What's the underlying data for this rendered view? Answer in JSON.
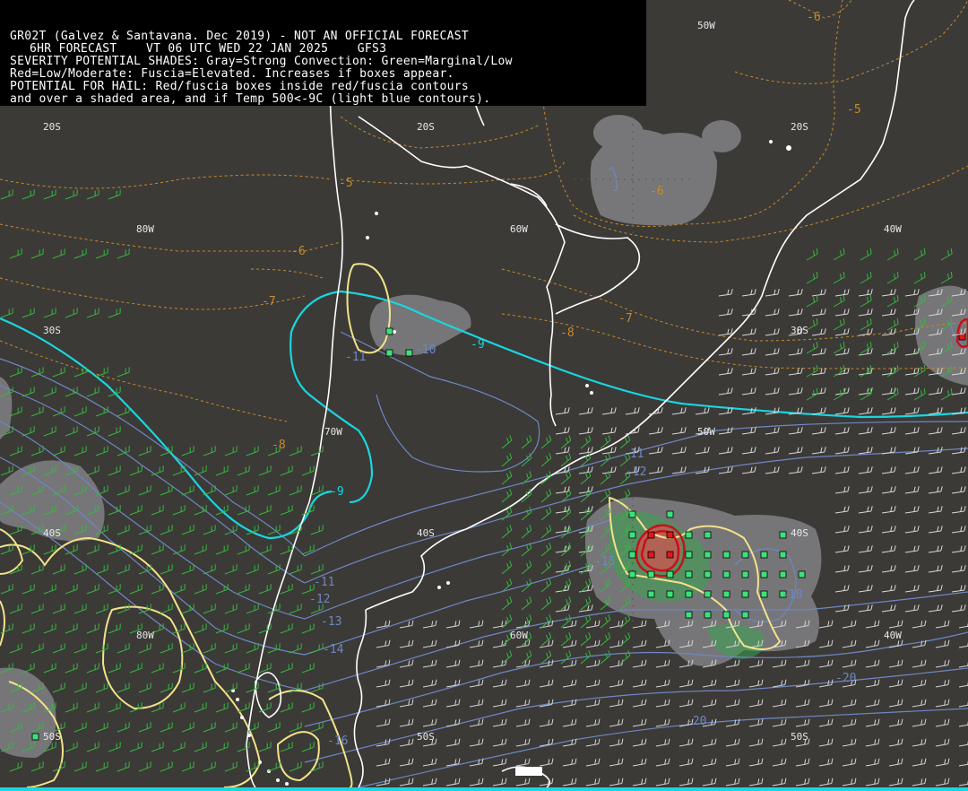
{
  "header": {
    "line1": "GR02T (Galvez & Santavana. Dec 2019) - NOT AN OFFICIAL FORECAST",
    "line2": "6HR FORECAST    VT 06 UTC WED 22 JAN 2025    GFS3",
    "line3": "SEVERITY POTENTIAL SHADES: Gray=Strong Convection: Green=Marginal/Low",
    "line4": "Red=Low/Moderate: Fuscia=Elevated. Increases if boxes appear.",
    "line5": "POTENTIAL FOR HAIL: Red/fuscia boxes inside red/fuscia contours",
    "line6": "and over a shaded area, and if Temp 500<-9C (light blue contours)."
  },
  "grid_labels": {
    "lat_20s_a": "20S",
    "lat_20s_b": "20S",
    "lat_20s_c": "20S",
    "lat_30s_a": "30S",
    "lat_30s_b": "30S",
    "lat_40s_a": "40S",
    "lat_40s_b": "40S",
    "lat_40s_c": "40S",
    "lat_50s_a": "50S",
    "lat_50s_b": "50S",
    "lat_50s_c": "50S",
    "lon_80w_a": "80W",
    "lon_80w_b": "80W",
    "lon_70w": "70W",
    "lon_60w_a": "60W",
    "lon_60w_b": "60W",
    "lon_50w_a": "50W",
    "lon_50w_b": "50W",
    "lon_40w_a": "40W",
    "lon_40w_b": "40W"
  },
  "contour_labels": {
    "orange_m5_a": "-5",
    "orange_m5_b": "-5",
    "orange_m6_a": "-6",
    "orange_m6_b": "-6",
    "orange_m6_c": "-6",
    "orange_m7_a": "-7",
    "orange_m7_b": "-7",
    "orange_m8_a": "-8",
    "orange_m8_b": "-8",
    "cyan_m9_a": "-9",
    "cyan_m9_b": "-9",
    "blue_m10": "-10",
    "blue_m11_a": "-11",
    "blue_m11_b": "-11",
    "blue_m11_c": "-11",
    "blue_m12_a": "-12",
    "blue_m12_b": "-12",
    "blue_m13": "-13",
    "blue_m14": "-14",
    "blue_m15": "-15",
    "blue_m16": "-16",
    "blue_m18": "-18",
    "blue_m20_a": "-20",
    "blue_m20_b": "-20"
  },
  "colors": {
    "background": "#3b3a37",
    "coastline": "#ffffff",
    "temp_cold_contour": "#19d6e0",
    "temp_contour": "#6f87c4",
    "orange_contour": "#c98a2a",
    "yellow_contour": "#f2e38a",
    "severity_gray": "#8a8a8e",
    "severity_green": "#2fa24a",
    "severity_red": "#d24040",
    "hail_box_green": "#3fe07a",
    "hail_box_red": "#e01818",
    "wind_barb_green": "#37b83f",
    "wind_barb_white": "#d8d8d8"
  }
}
